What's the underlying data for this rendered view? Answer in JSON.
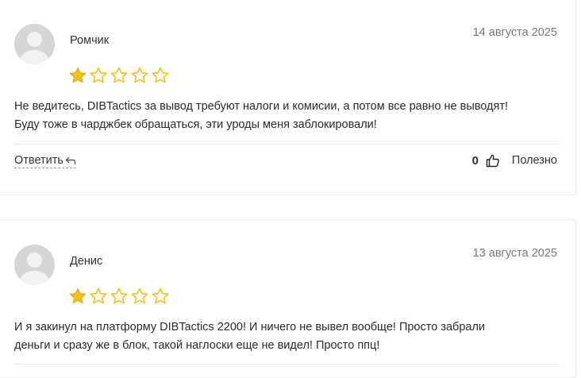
{
  "reviews": [
    {
      "author": "Ромчик",
      "date": "14 августа 2025",
      "rating": 1,
      "max_rating": 5,
      "text_line1": "Не ведитесь, DIBTactics за вывод требуют налоги и комисии, а потом все равно не выводят!",
      "text_line2": "Буду тоже в чарджбек обращаться, эти уроды меня заблокировали!",
      "reply_label": "Ответить",
      "helpful_count": "0",
      "helpful_label": "Полезно"
    },
    {
      "author": "Денис",
      "date": "13 августа 2025",
      "rating": 1,
      "max_rating": 5,
      "text_line1": "И я закинул на платформу DIBTactics 2200! И ничего не вывел вообще! Просто забрали",
      "text_line2": "деньги и сразу же в блок, такой наглоски еще не видел! Просто ппц!"
    }
  ],
  "colors": {
    "star": "#f2c21b",
    "border": "#ececec",
    "avatar": "#d6d6d6"
  },
  "icons": {
    "avatar": "user-avatar-icon",
    "star": "star-icon",
    "reply": "reply-arrow-icon",
    "like": "thumbs-up-icon"
  }
}
